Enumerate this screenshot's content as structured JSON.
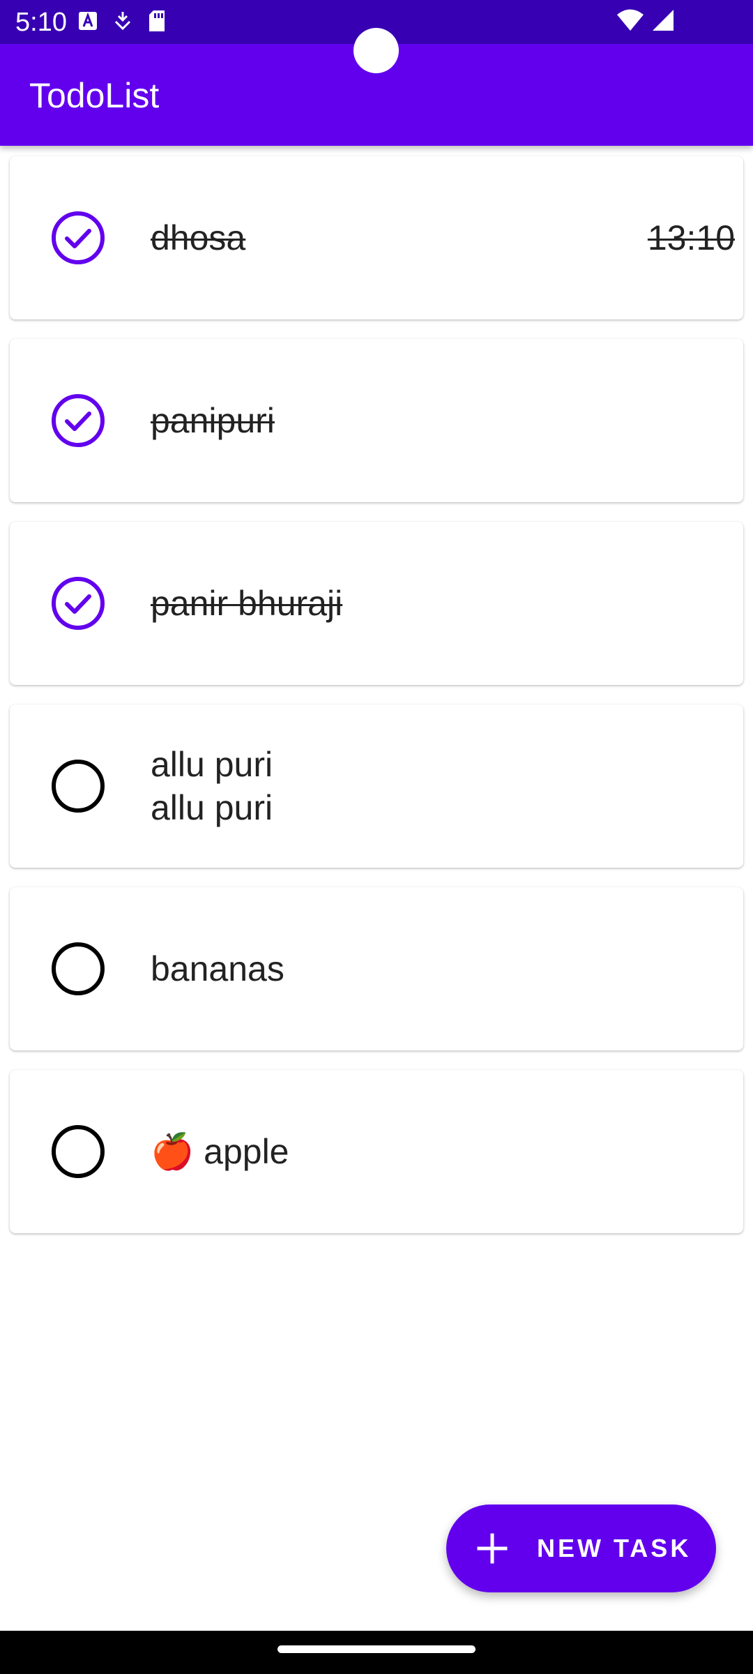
{
  "status_bar": {
    "time": "5:10",
    "color": "#3700b3",
    "left_icons": [
      "font-download-icon",
      "cast-icon",
      "sd-card-icon"
    ],
    "right_icons": [
      "wifi-icon",
      "signal-icon"
    ]
  },
  "app_bar": {
    "title": "TodoList",
    "color": "#6200ee"
  },
  "tasks": [
    {
      "text": "dhosa",
      "time": "13:10",
      "done": true
    },
    {
      "text": "panipuri",
      "time": "",
      "done": true
    },
    {
      "text": "panir bhuraji",
      "time": "",
      "done": true
    },
    {
      "text": "allu puri\nallu puri",
      "time": "",
      "done": false
    },
    {
      "text": "bananas",
      "time": "",
      "done": false
    },
    {
      "text": "🍎 apple",
      "time": "",
      "done": false
    }
  ],
  "fab": {
    "label": "NEW TASK",
    "icon": "plus-icon"
  },
  "accent_color": "#6200ee"
}
